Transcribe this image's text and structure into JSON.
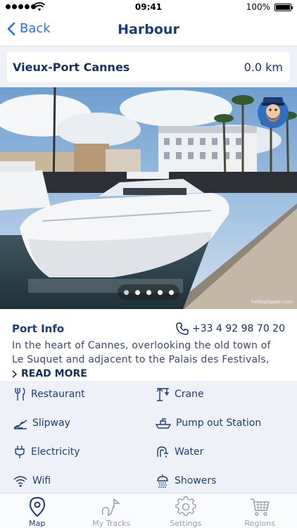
{
  "status_bar": {
    "time": "09:41",
    "battery": "100%"
  },
  "nav": {
    "back_label": "Back",
    "title": "Harbour"
  },
  "harbour": {
    "name": "Vieux-Port Cannes",
    "distance": "0.0 km"
  },
  "photo": {
    "watermark": "helloskipper.com",
    "page_count": 5,
    "active_page": 1
  },
  "port_info": {
    "title": "Port Info",
    "phone": "+33 4 92 98 70 20",
    "description": "In the heart of Cannes, overlooking the old town of Le Suquet and adjacent to the Palais des Festivals, this…",
    "read_more": "READ MORE"
  },
  "facilities": [
    {
      "label": "Restaurant",
      "icon": "fork-knife-icon"
    },
    {
      "label": "Crane",
      "icon": "crane-icon"
    },
    {
      "label": "Slipway",
      "icon": "slipway-icon"
    },
    {
      "label": "Pump out Station",
      "icon": "pump-out-icon"
    },
    {
      "label": "Electricity",
      "icon": "plug-icon"
    },
    {
      "label": "Water",
      "icon": "tap-icon"
    },
    {
      "label": "Wifi",
      "icon": "wifi-icon"
    },
    {
      "label": "Showers",
      "icon": "shower-icon"
    }
  ],
  "tabs": [
    {
      "label": "Map",
      "icon": "map-pin-icon",
      "active": true
    },
    {
      "label": "My Tracks",
      "icon": "tracks-icon",
      "active": false
    },
    {
      "label": "Settings",
      "icon": "gear-icon",
      "active": false
    },
    {
      "label": "Regions",
      "icon": "cart-icon",
      "active": false
    }
  ],
  "colors": {
    "accent": "#1f74e6",
    "navy": "#1b3c78",
    "background": "#eef2f8"
  }
}
